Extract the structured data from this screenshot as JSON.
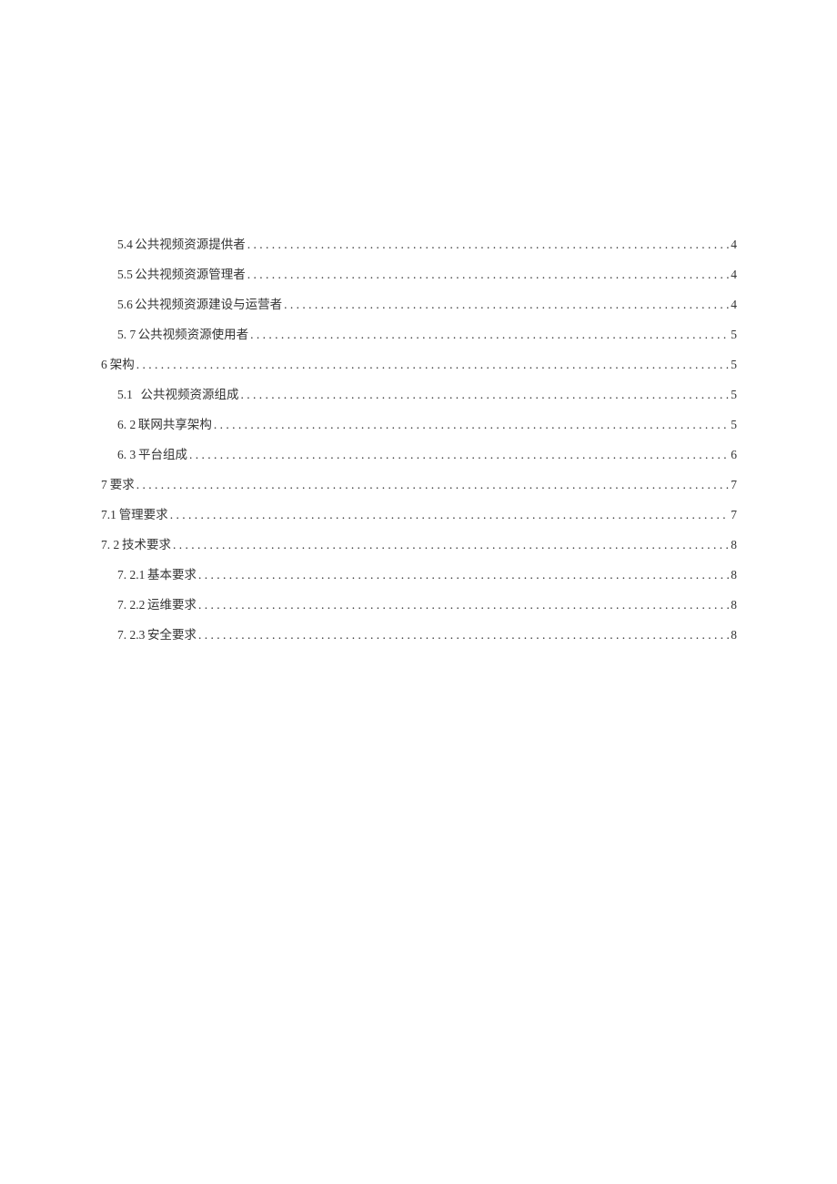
{
  "toc": [
    {
      "indent": 1,
      "num": "5.4",
      "gap": "nar",
      "title": "公共视频资源提供者",
      "page": "4"
    },
    {
      "indent": 1,
      "num": "5.5",
      "gap": "nar",
      "title": "公共视频资源管理者",
      "page": "4"
    },
    {
      "indent": 1,
      "num": "5.6",
      "gap": "nar",
      "title": "公共视频资源建设与运营者",
      "page": "4"
    },
    {
      "indent": 1,
      "num": "5.  7",
      "gap": "nar",
      "title": "公共视频资源使用者",
      "page": "5"
    },
    {
      "indent": 0,
      "num": "6",
      "gap": "nar",
      "title": "架构",
      "page": "5"
    },
    {
      "indent": 1,
      "num": "5.1",
      "gap": "wide",
      "title": "公共视频资源组成",
      "page": "5"
    },
    {
      "indent": 1,
      "num": "6.  2",
      "gap": "nar",
      "title": "联网共享架构",
      "page": "5"
    },
    {
      "indent": 1,
      "num": "6.  3",
      "gap": "nar",
      "title": "平台组成",
      "page": "6"
    },
    {
      "indent": 0,
      "num": "7",
      "gap": "nar",
      "title": "要求",
      "page": "7"
    },
    {
      "indent": 0,
      "num": "7.1",
      "gap": "nar",
      "title": "管理要求",
      "page": "7"
    },
    {
      "indent": 0,
      "num": "7.  2",
      "gap": "nar",
      "title": "技术要求",
      "page": "8"
    },
    {
      "indent": 2,
      "num": "7.  2.1",
      "gap": "nar",
      "title": "基本要求",
      "page": "8"
    },
    {
      "indent": 2,
      "num": "7.  2.2",
      "gap": "nar",
      "title": "运维要求",
      "page": "8"
    },
    {
      "indent": 2,
      "num": "7.  2.3",
      "gap": "nar",
      "title": "安全要求",
      "page": "8"
    }
  ]
}
